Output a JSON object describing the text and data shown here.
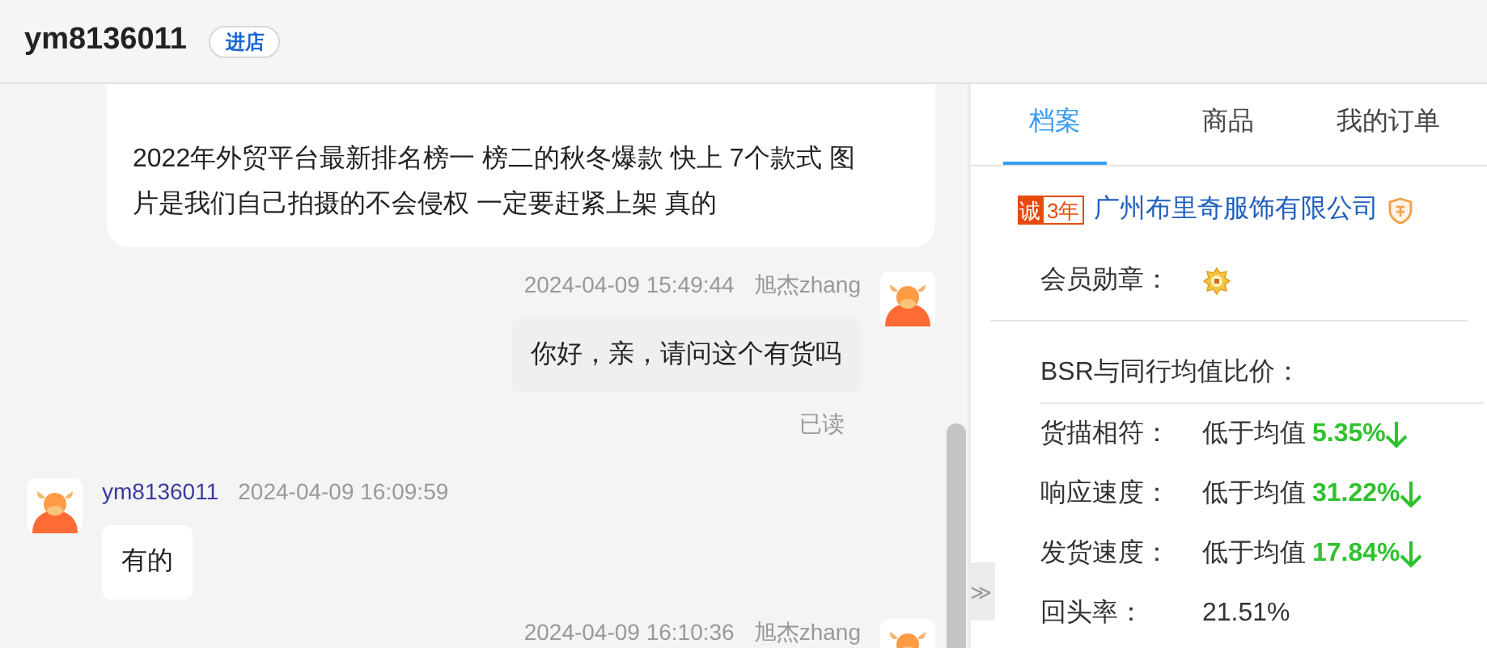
{
  "header": {
    "title": "ym8136011",
    "shop_button": "进店"
  },
  "messages": [
    {
      "kind": "received",
      "text": "2022年外贸平台最新排名榜一 榜二的秋冬爆款 快上 7个款式 图片是我们自己拍摄的不会侵权 一定要赶紧上架 真的"
    },
    {
      "kind": "sent",
      "time": "2024-04-09 15:49:44",
      "sender": "旭杰zhang",
      "text": "你好，亲，请问这个有货吗",
      "status": "已读"
    },
    {
      "kind": "received",
      "time": "2024-04-09 16:09:59",
      "sender": "ym8136011",
      "text": "有的"
    },
    {
      "kind": "sent",
      "time": "2024-04-09 16:10:36",
      "sender": "旭杰zhang"
    }
  ],
  "collapse_button": "≫",
  "tabs": [
    {
      "label": "档案",
      "selected": true
    },
    {
      "label": "商品",
      "selected": false
    },
    {
      "label": "我的订单",
      "selected": false
    }
  ],
  "company": {
    "badge": "诚",
    "years": "3年",
    "name": "广州布里奇服饰有限公司"
  },
  "member_badge_label": "会员勋章：",
  "bsr_title": "BSR与同行均值比价：",
  "metrics": [
    {
      "kind": "below_average",
      "label": "货描相符：",
      "prefix": "低于均值",
      "value": "5.35%"
    },
    {
      "kind": "below_average",
      "label": "响应速度：",
      "prefix": "低于均值",
      "value": "31.22%"
    },
    {
      "kind": "below_average",
      "label": "发货速度：",
      "prefix": "低于均值",
      "value": "17.84%"
    },
    {
      "kind": "plain",
      "label": "回头率：",
      "value": "21.51%"
    }
  ]
}
